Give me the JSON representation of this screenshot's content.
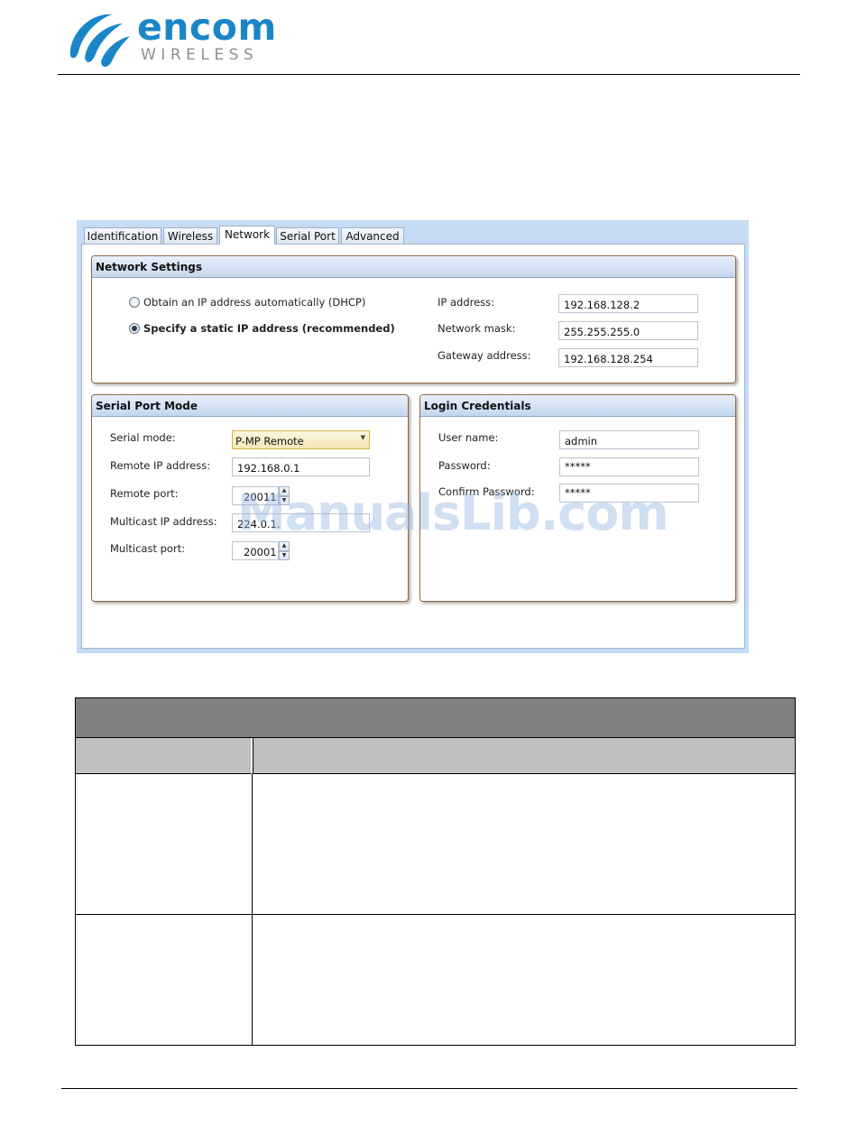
{
  "header": {
    "brand": "encom",
    "brand_sub": "WIRELESS"
  },
  "dialog": {
    "tabs": [
      "Identification",
      "Wireless",
      "Network",
      "Serial Port",
      "Advanced"
    ],
    "active_tab": "Network",
    "network_settings": {
      "title": "Network Settings",
      "dhcp_label": "Obtain an IP address automatically (DHCP)",
      "static_label": "Specify a static IP address (recommended)",
      "selected": "static",
      "ip_label": "IP address:",
      "ip_value": "192.168.128.2",
      "mask_label": "Network mask:",
      "mask_value": "255.255.255.0",
      "gateway_label": "Gateway address:",
      "gateway_value": "192.168.128.254"
    },
    "serial_port_mode": {
      "title": "Serial Port Mode",
      "mode_label": "Serial mode:",
      "mode_value": "P-MP Remote",
      "remote_ip_label": "Remote IP address:",
      "remote_ip_value": "192.168.0.1",
      "remote_port_label": "Remote port:",
      "remote_port_value": "20011",
      "multicast_ip_label": "Multicast IP address:",
      "multicast_ip_value": "224.0.1.",
      "multicast_port_label": "Multicast port:",
      "multicast_port_value": "20001"
    },
    "login_credentials": {
      "title": "Login Credentials",
      "user_label": "User name:",
      "user_value": "admin",
      "password_label": "Password:",
      "password_value": "*****",
      "confirm_label": "Confirm Password:",
      "confirm_value": "*****"
    }
  },
  "watermark": "ManualsLib.com",
  "colors": {
    "brand_blue": "#1a86c8",
    "table_header": "#808080",
    "table_subheader": "#c0c0c0"
  }
}
